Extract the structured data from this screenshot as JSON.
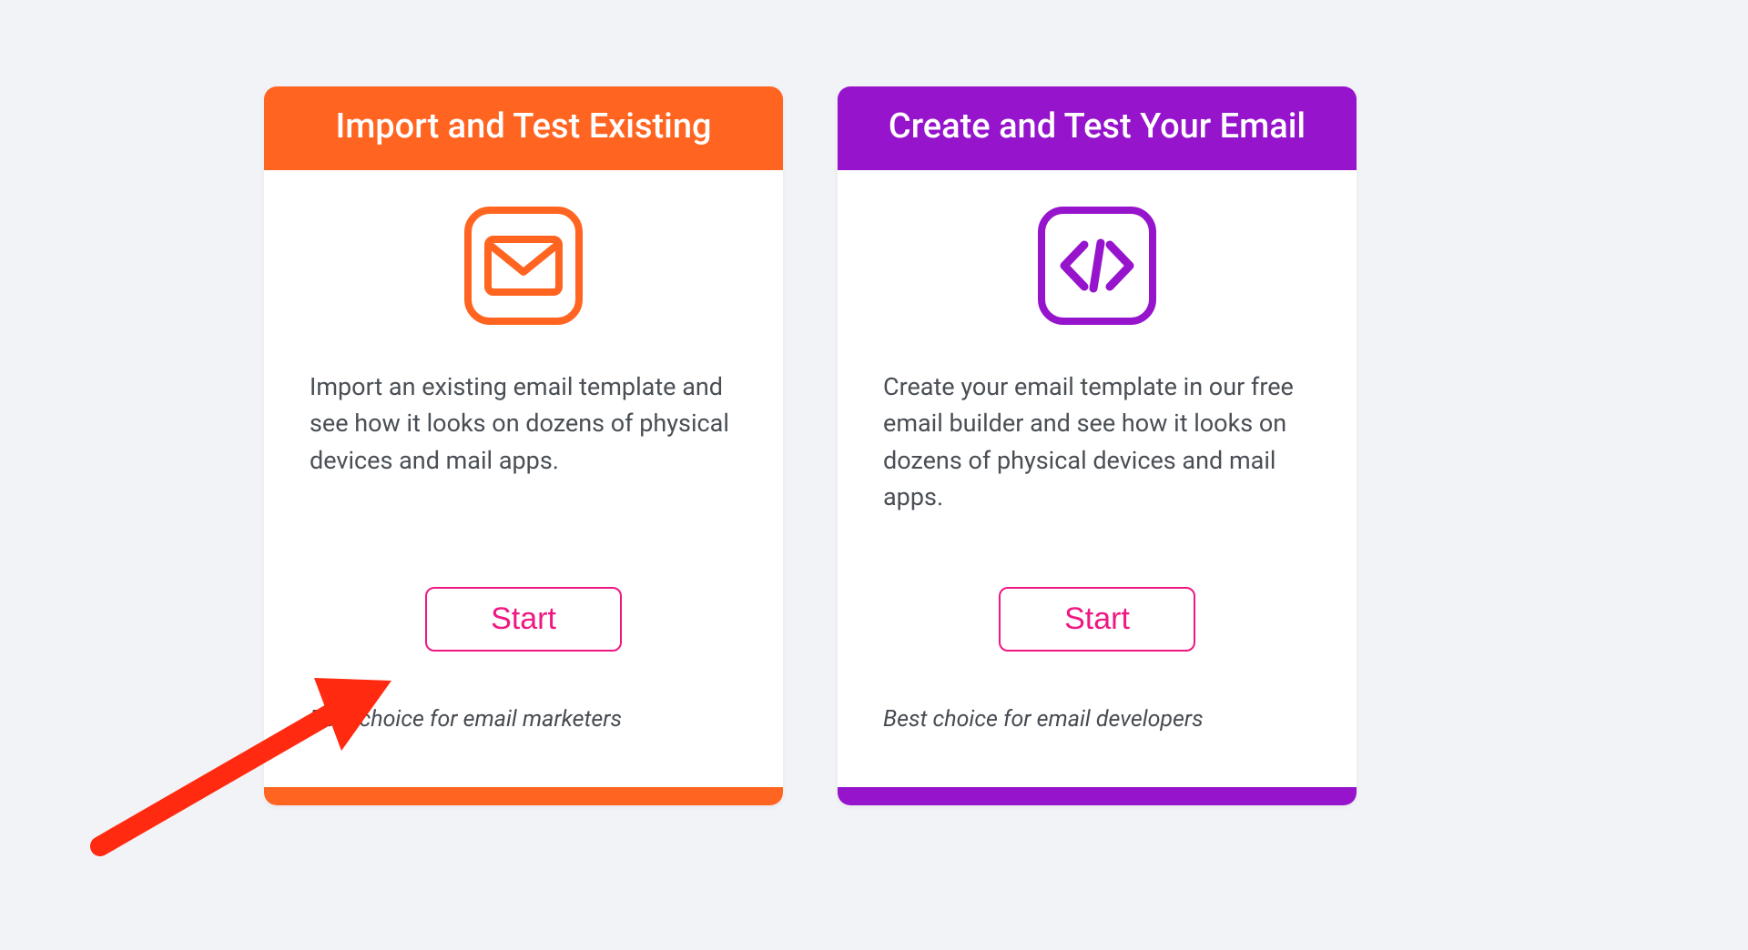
{
  "cards": [
    {
      "title": "Import and Test Existing",
      "desc": "Import an existing email template and see how it looks on dozens of physical devices and mail apps.",
      "button": "Start",
      "footer": "Best choice for email marketers"
    },
    {
      "title": "Create and Test Your Email",
      "desc": "Create your email template in our free email builder and see how it looks on dozens of physical devices and mail apps.",
      "button": "Start",
      "footer": "Best choice for email developers"
    }
  ],
  "colors": {
    "orange": "#ff6521",
    "purple": "#9614cc",
    "pink": "#ef1883",
    "arrow": "#ff2a0f"
  }
}
